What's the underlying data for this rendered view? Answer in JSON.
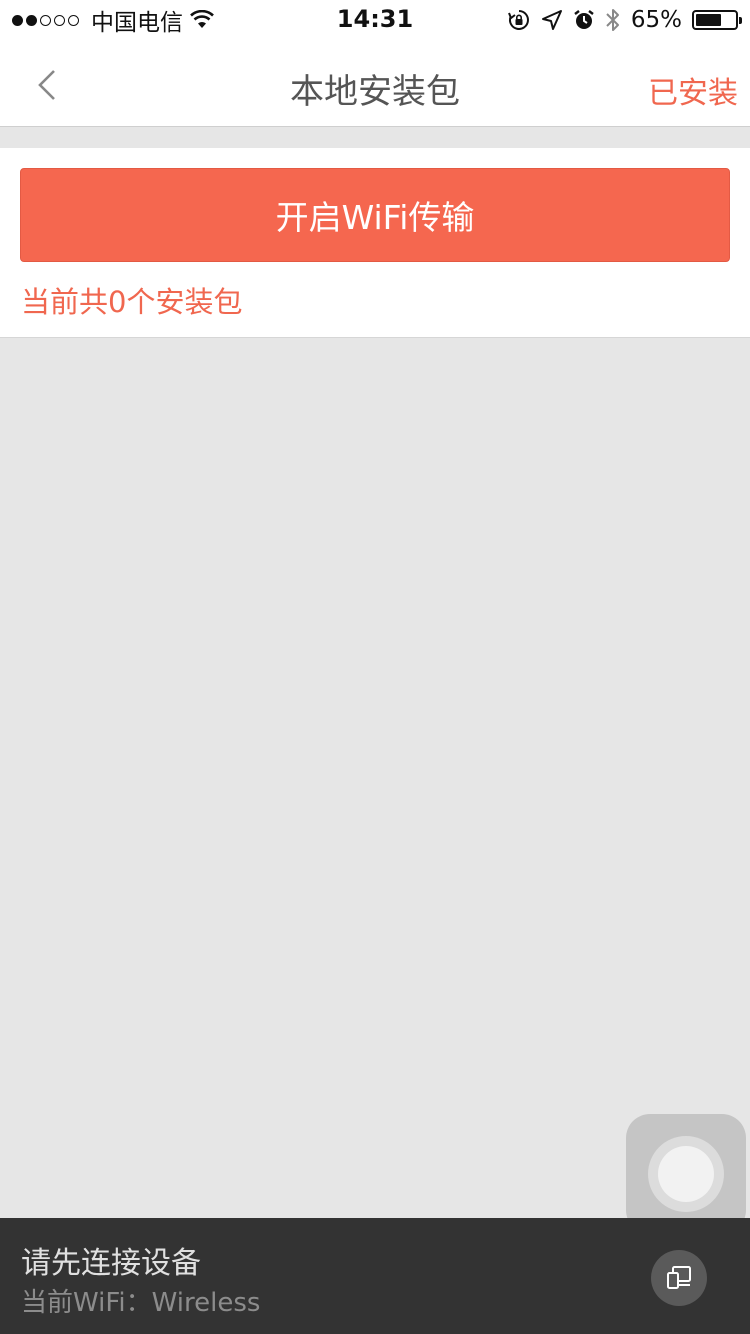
{
  "status_bar": {
    "signal_filled": 2,
    "signal_total": 5,
    "carrier": "中国电信",
    "time": "14:31",
    "battery_percent": "65%",
    "battery_level": 0.65
  },
  "nav": {
    "title": "本地安装包",
    "right_link": "已安装"
  },
  "main": {
    "wifi_button_label": "开启WiFi传输",
    "package_count_text": "当前共0个安装包"
  },
  "bottom_bar": {
    "prompt": "请先连接设备",
    "current_wifi": "当前WiFi：Wireless"
  },
  "colors": {
    "accent": "#f5674f",
    "accent_text": "#f0674f",
    "bottom_bar_bg": "#333333"
  },
  "icons": {
    "back": "chevron-left-icon",
    "wifi": "wifi-icon",
    "rotation_lock": "rotation-lock-icon",
    "location": "location-arrow-icon",
    "alarm": "alarm-clock-icon",
    "bluetooth": "bluetooth-icon",
    "battery": "battery-icon",
    "device": "devices-icon"
  }
}
